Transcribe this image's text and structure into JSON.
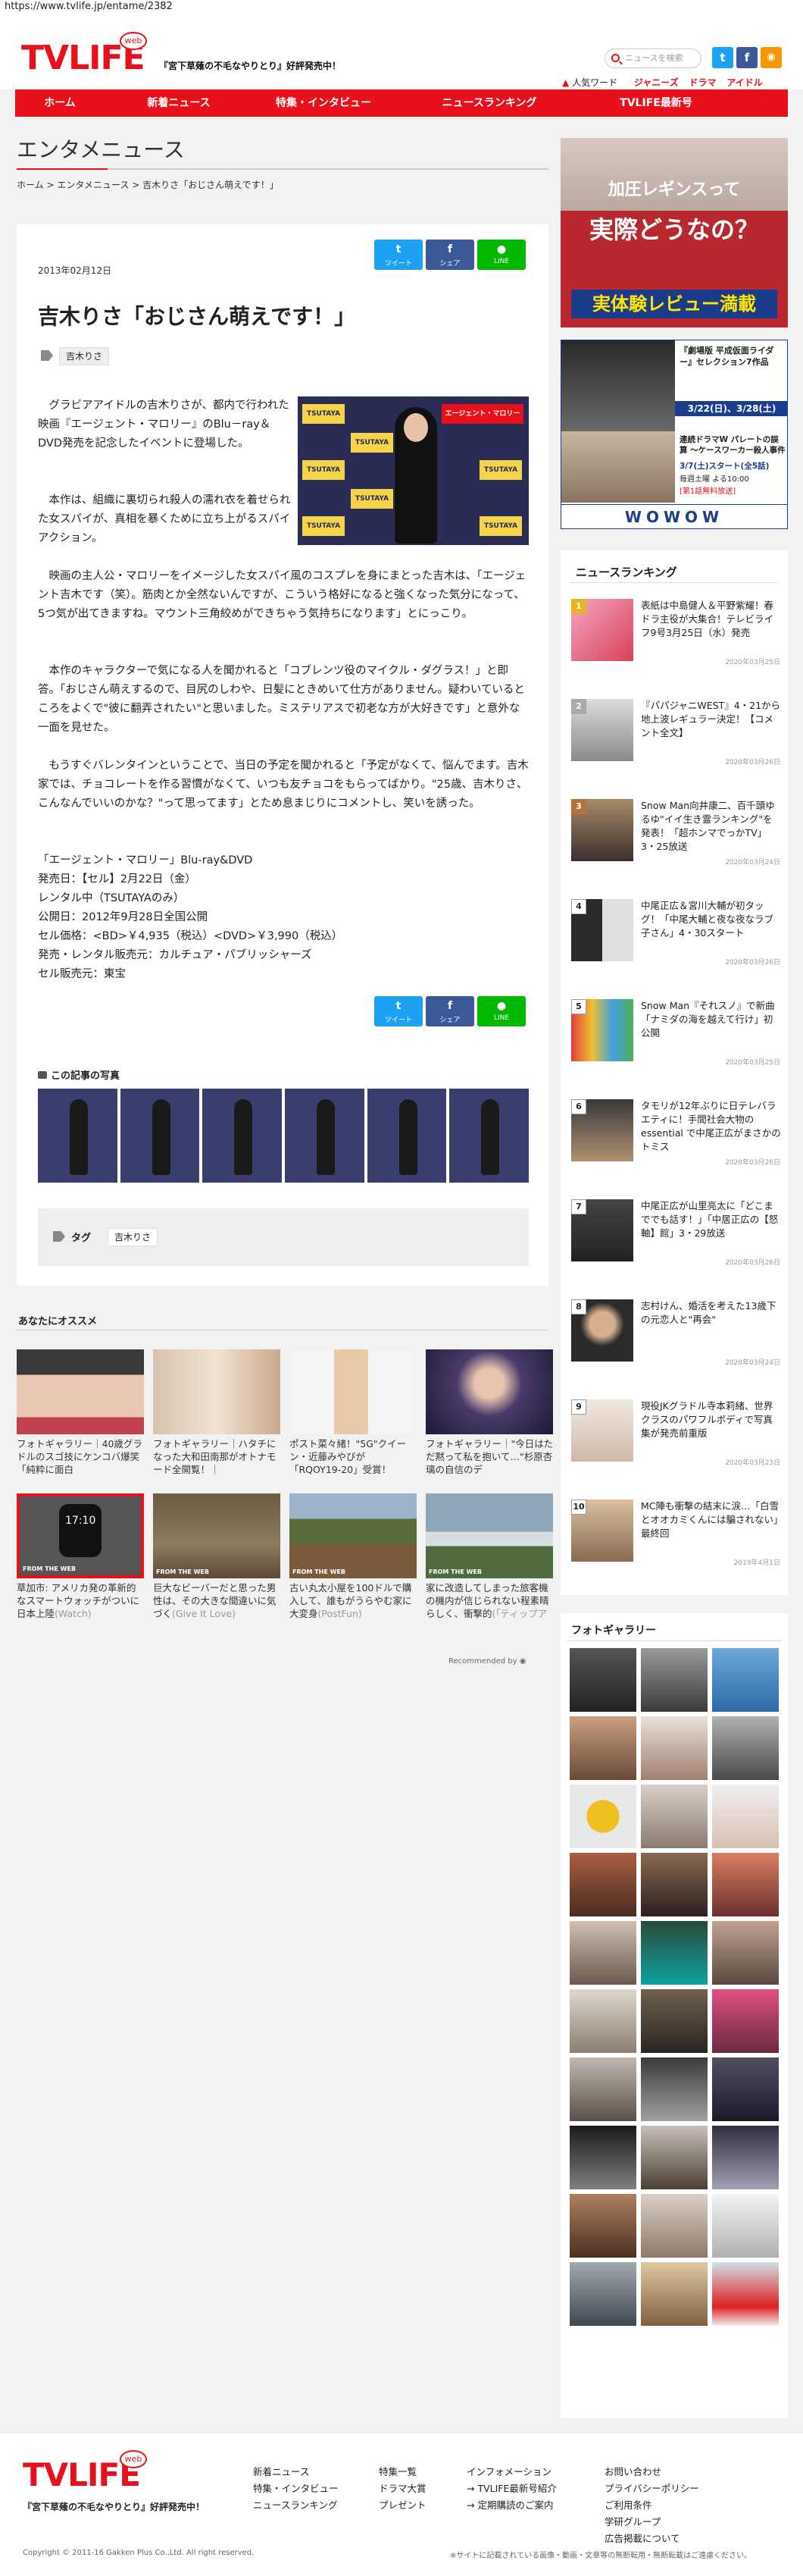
{
  "url": "https://www.tvlife.jp/entame/2382",
  "header": {
    "logo": "TVLIFE",
    "logo_badge": "web",
    "tagline": "『宮下草薙の不毛なやりとり』好評発売中！",
    "search_placeholder": "ニュースを検索",
    "popular_label": "人気ワード",
    "popular_words": [
      "ジャニーズ",
      "ドラマ",
      "アイドル"
    ],
    "social": [
      "twitter",
      "facebook",
      "rss"
    ]
  },
  "nav": [
    "ホーム",
    "新着ニュース",
    "特集・インタビュー",
    "ニュースランキング",
    "TVLIFE最新号"
  ],
  "section": {
    "title": "エンタメニュース",
    "breadcrumb": [
      "ホーム",
      "エンタメニュース",
      "吉木りさ「おじさん萌えです！」"
    ]
  },
  "article": {
    "date": "2013年02月12日",
    "share": {
      "tweet": "ツイート",
      "share": "シェア",
      "line": "LINE"
    },
    "title": "吉木りさ「おじさん萌えです！」",
    "tag": "吉木りさ",
    "paragraphs": [
      "グラビアアイドルの吉木りさが、都内で行われた映画『エージェント・マロリー』のBlu－ray＆DVD発売を記念したイベントに登場した。",
      "本作は、組織に裏切られ殺人の濡れ衣を着せられた女スパイが、真相を暴くために立ち上がるスパイアクション。",
      "映画の主人公・マロリーをイメージした女スパイ風のコスプレを身にまとった吉木は、「エージェント吉木です（笑）。筋肉とか全然ないんですが、こういう格好になると強くなった気分になって、5つ気が出てきますね。マウント三角絞めができちゃう気持ちになります」とにっこり。",
      "本作のキャラクターで気になる人を聞かれると「コブレンツ役のマイクル・ダグラス！」と即答。「おじさん萌えするので、目尻のしわや、日髪にときめいて仕方がありません。疑わいているところをよくで\"彼に翻弄されたい\"と思いました。ミステリアスで初老な方が大好きです」と意外な一面を見せた。",
      "もうすぐバレンタインということで、当日の予定を聞かれると「予定がなくて、悩んでます。吉木家では、チョコレートを作る習慣がなくて、いつも友チョコをもらってばかり。\"25歳、吉木りさ、こんなんでいいのかな？\"って思ってます」とため息まじりにコメントし、笑いを誘った。"
    ],
    "product": [
      "「エージェント・マロリー」Blu-ray&DVD",
      "発売日：【セル】2月22日（金）",
      "レンタル中（TSUTAYAのみ）",
      "公開日：2012年9月28日全国公開",
      "セル価格：<BD>￥4,935（税込）<DVD>￥3,990（税込）",
      "発売・レンタル販売元：カルチュア・パブリッシャーズ",
      "セル販売元：東宝"
    ],
    "photo_logos": [
      "TSUTAYA",
      "エージェント・マロリー"
    ],
    "photos_heading": "この記事の写真",
    "tags_label": "タグ"
  },
  "recommend": {
    "heading": "あなたにオススメ",
    "items": [
      {
        "caption": "フォトギャラリー｜40歳グラドルのスゴ技にケンコバ爆笑「純粋に面白",
        "source": ""
      },
      {
        "caption": "フォトギャラリー｜ハタチになった大和田南那がオトナモード全開覧！｜",
        "source": ""
      },
      {
        "caption": "ポスト菜々緒！\"5G\"クイーン・近藤みやびが「RQOY19-20」受賞！",
        "source": ""
      },
      {
        "caption": "フォトギャラリー｜\"今日はただ黙って私を抱いて…\"杉原杏璃の自信のデ",
        "source": ""
      },
      {
        "caption": "草加市: アメリカ発の革新的なスマートウォッチがついに日本上陸",
        "source": "(Watch)"
      },
      {
        "caption": "巨大なビーバーだと思った男性は、その大きな間違いに気づく",
        "source": "(Give It Love)"
      },
      {
        "caption": "古い丸太小屋を100ドルで購入して、誰もがうらやむ家に大変身",
        "source": "(PostFun)"
      },
      {
        "caption": "家に改造してしまった旅客機の機内が信じられない程素晴らしく、衝撃的",
        "source": "(「ティップアンドトリック」)"
      }
    ],
    "from_web": "FROM THE WEB",
    "watch_time": "17:10",
    "recommended_by": "Recommended by"
  },
  "ads": {
    "ad1_line1": "加圧レギンスって",
    "ad1_line2": "実際どうなの？",
    "ad1_line3": "実体験レビュー満載",
    "ad2_title": "『劇場版 平成仮面ライダー』セレクション7作品",
    "ad2_date1": "3/22(日)、3/28(土)",
    "ad2_drama": "連続ドラマW パレートの誤算 〜ケースワーカー殺人事件",
    "ad2_date2": "3/7(土)スタート(全5話)",
    "ad2_time": "毎週土曜 よる10:00",
    "ad2_note": "[第1話無料放送]",
    "ad2_brand": "WOWOW"
  },
  "ranking": {
    "heading": "ニュースランキング",
    "items": [
      {
        "rank": "1",
        "text": "表紙は中島健人＆平野紫耀！春ドラ主役が大集合！テレビライフ9号3月25日（水）発売",
        "date": "2020年03月25日"
      },
      {
        "rank": "2",
        "text": "『パパジャニWEST』4・21から地上波レギュラー決定！【コメント全文】",
        "date": "2020年03月26日"
      },
      {
        "rank": "3",
        "text": "Snow Man向井康二、百千頭ゆるゆ\"イイ生き霊ランキング\"を発表！「超ホンマでっかTV」3・25放送",
        "date": "2020年03月24日"
      },
      {
        "rank": "4",
        "text": "中尾正広＆宮川大輔が初タッグ！「中尾大輔と夜な夜なラブ子さん」4・30スタート",
        "date": "2020年03月26日"
      },
      {
        "rank": "5",
        "text": "Snow Man『それスノ』で新曲「ナミダの海を越えて行け」初公開",
        "date": "2020年03月25日"
      },
      {
        "rank": "6",
        "text": "タモリが12年ぶりに日テレバラエティに！手間社会大物の essential で中尾正広がまさかのトミス",
        "date": "2020年03月26日"
      },
      {
        "rank": "7",
        "text": "中尾正広が山里亮太に「どこまででも話す！」「中居正広の【怒軸】館」3・29放送",
        "date": "2020年03月26日"
      },
      {
        "rank": "8",
        "text": "志村けん、婚活を考えた13歳下の元恋人と\"再会\"",
        "date": "2020年03月24日"
      },
      {
        "rank": "9",
        "text": "現役JKグラドル寺本莉緒、世界クラスのパワフルボディで写真集が発売前重版",
        "date": "2020年03月23日"
      },
      {
        "rank": "10",
        "text": "MC陣も衝撃の結末に涙…「白雪とオオカミくんには騙されない」最終回",
        "date": "2019年4月1日"
      }
    ]
  },
  "gallery": {
    "heading": "フォトギャラリー"
  },
  "footer": {
    "logo": "TVLIFE",
    "tagline": "『宮下草薙の不毛なやりとり』好評発売中！",
    "col1": [
      "新着ニュース",
      "特集・インタビュー",
      "ニュースランキング"
    ],
    "col2": [
      "特集一覧",
      "ドラマ大賞",
      "プレゼント"
    ],
    "col3": [
      "インフォメーション",
      "TVLIFE最新号紹介",
      "定期購読のご案内"
    ],
    "col4": [
      "お問い合わせ",
      "プライバシーポリシー",
      "ご利用条件",
      "学研グループ",
      "広告掲載について"
    ],
    "copyright": "Copyright © 2011-16 Gakken Plus Co.,Ltd. All right reserved.",
    "note": "※サイトに記載されている画像・動画・文章等の無断転用・無断転載はご遠慮ください。"
  },
  "colors": {
    "brand": "#e8101a",
    "twitter": "#1da1f2",
    "facebook": "#3b5998",
    "line": "#00b900"
  }
}
